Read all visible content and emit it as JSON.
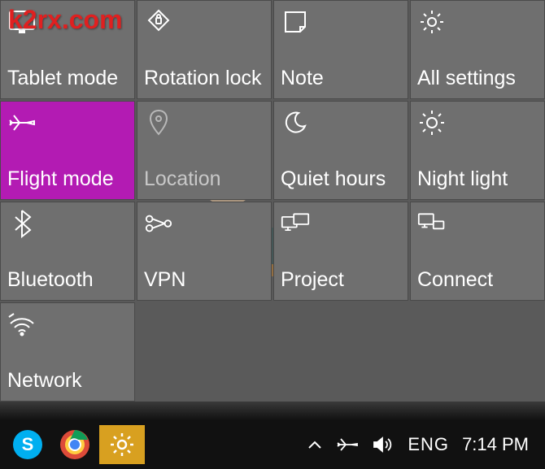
{
  "watermark": "k2rx.com",
  "tiles": [
    {
      "id": "tablet-mode",
      "label": "Tablet mode",
      "icon": "tablet-icon",
      "active": false
    },
    {
      "id": "rotation-lock",
      "label": "Rotation lock",
      "icon": "rotation-lock-icon",
      "active": false
    },
    {
      "id": "note",
      "label": "Note",
      "icon": "note-icon",
      "active": false
    },
    {
      "id": "all-settings",
      "label": "All settings",
      "icon": "gear-icon",
      "active": false
    },
    {
      "id": "flight-mode",
      "label": "Flight mode",
      "icon": "airplane-icon",
      "active": true
    },
    {
      "id": "location",
      "label": "Location",
      "icon": "location-icon",
      "active": false
    },
    {
      "id": "quiet-hours",
      "label": "Quiet hours",
      "icon": "moon-icon",
      "active": false
    },
    {
      "id": "night-light",
      "label": "Night light",
      "icon": "sun-icon",
      "active": false
    },
    {
      "id": "bluetooth",
      "label": "Bluetooth",
      "icon": "bluetooth-icon",
      "active": false
    },
    {
      "id": "vpn",
      "label": "VPN",
      "icon": "vpn-icon",
      "active": false
    },
    {
      "id": "project",
      "label": "Project",
      "icon": "project-icon",
      "active": false
    },
    {
      "id": "connect",
      "label": "Connect",
      "icon": "connect-icon",
      "active": false
    },
    {
      "id": "network",
      "label": "Network",
      "icon": "wifi-icon",
      "active": false
    }
  ],
  "taskbar": {
    "apps": [
      "skype",
      "chrome",
      "settings"
    ],
    "tray": {
      "chevron": "^",
      "lang": "ENG",
      "time": "7:14 PM"
    }
  }
}
